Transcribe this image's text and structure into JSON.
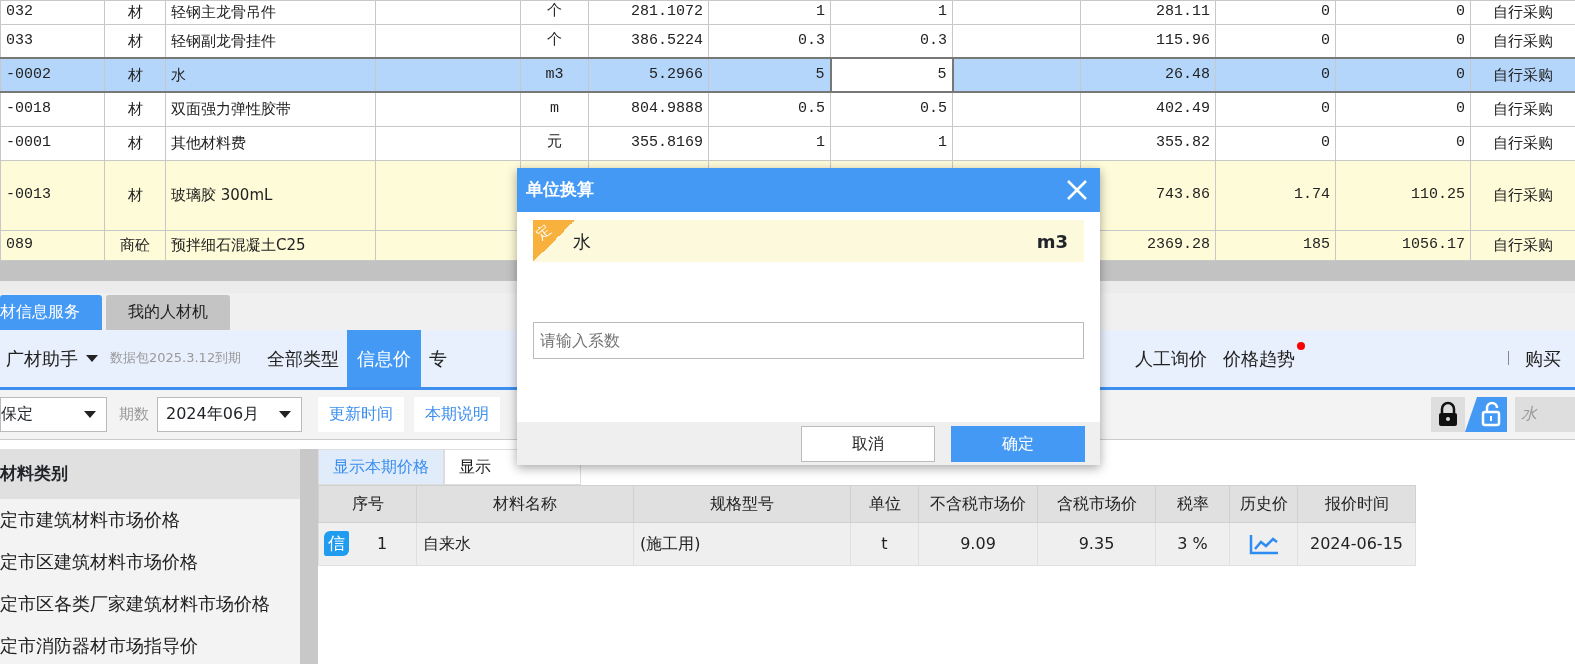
{
  "grid": {
    "rows": [
      {
        "selected": false,
        "highlight": false,
        "cells": {
          "column_1": "032",
          "column_2": "材",
          "column_3": "轻钢主龙骨吊件",
          "column_5": "个",
          "column_6": "281.1072",
          "column_7": "1",
          "column_8": "1",
          "column_10": "281.11",
          "column_11": "0",
          "column_12": "0",
          "column_13": "自行采购"
        }
      },
      {
        "selected": false,
        "highlight": false,
        "cells": {
          "column_1": "033",
          "column_2": "材",
          "column_3": "轻钢副龙骨挂件",
          "column_5": "个",
          "column_6": "386.5224",
          "column_7": "0.3",
          "column_8": "0.3",
          "column_10": "115.96",
          "column_11": "0",
          "column_12": "0",
          "column_13": "自行采购"
        }
      },
      {
        "selected": true,
        "highlight": false,
        "cells": {
          "column_1": "-0002",
          "column_2": "材",
          "column_3": "水",
          "column_5": "m3",
          "column_6": "5.2966",
          "column_7": "5",
          "column_8": {
            "text": "5",
            "focused": true
          },
          "column_10": "26.48",
          "column_11": "0",
          "column_12": "0",
          "column_13": "自行采购"
        }
      },
      {
        "selected": false,
        "highlight": false,
        "cells": {
          "column_1": "-0018",
          "column_2": "材",
          "column_3": "双面强力弹性胶带",
          "column_5": "m",
          "column_6": "804.9888",
          "column_7": "0.5",
          "column_8": "0.5",
          "column_10": "402.49",
          "column_11": "0",
          "column_12": "0",
          "column_13": "自行采购"
        }
      },
      {
        "selected": false,
        "highlight": false,
        "cells": {
          "column_1": "-0001",
          "column_2": "材",
          "column_3": "其他材料费",
          "column_5": "元",
          "column_6": "355.8169",
          "column_7": "1",
          "column_8": "1",
          "column_10": "355.82",
          "column_11": "0",
          "column_12": "0",
          "column_13": "自行采购"
        }
      },
      {
        "selected": false,
        "highlight": true,
        "cells": {
          "column_1": "-0013",
          "column_2": "材",
          "column_3": "玻璃胶 300mL",
          "column_10": "743.86",
          "column_11": "1.74",
          "column_12": "110.25",
          "column_13": "自行采购"
        }
      },
      {
        "selected": false,
        "highlight": true,
        "cells": {
          "column_1": "089",
          "column_2": "商砼",
          "column_3": "预拌细石混凝土C25",
          "column_10": "2369.28",
          "column_11": "185",
          "column_12": "1056.17",
          "column_13": "自行采购"
        }
      }
    ]
  },
  "pane_tabs": [
    {
      "label": "材信息服务",
      "selected": true
    },
    {
      "label": "我的人材机",
      "selected": false
    }
  ],
  "toolbar": {
    "brand": "广材助手",
    "notice": "数据包2025.3.12到期",
    "items": [
      {
        "label": "全部类型",
        "selected": false,
        "dot": false
      },
      {
        "label": "信息价",
        "selected": true,
        "dot": false
      },
      {
        "label": "专",
        "selected": false,
        "dot": false
      },
      {
        "label": "人工询价",
        "selected": false,
        "dot": false
      },
      {
        "label": "价格趋势",
        "selected": false,
        "dot": true
      }
    ],
    "buy": "购买"
  },
  "filters": {
    "region": "保定",
    "period_label": "期数",
    "period": "2024年06月",
    "buttons": [
      "更新时间",
      "本期说明"
    ],
    "locked": false,
    "search": {
      "value": "水"
    }
  },
  "categories": {
    "title": "材料类别",
    "items": [
      "定市建筑材料市场价格",
      "定市区建筑材料市场价格",
      "定市区各类厂家建筑材料市场价格",
      "定市消防器材市场指导价"
    ]
  },
  "price_tabs": [
    {
      "label": "显示本期价格",
      "selected": true
    },
    {
      "label": "显示",
      "selected": false
    }
  ],
  "price_table": {
    "columns": [
      "序号",
      "材料名称",
      "规格型号",
      "单位",
      "不含税市场价",
      "含税市场价",
      "税率",
      "历史价",
      "报价时间"
    ],
    "rows": [
      {
        "badge": "信",
        "index": "1",
        "name": "自来水",
        "spec": "(施工用)",
        "unit": "t",
        "price_ex_tax": "9.09",
        "price_inc_tax": "9.35",
        "tax_rate": "3 %",
        "date": "2024-06-15"
      }
    ]
  },
  "dialog": {
    "title": "单位换算",
    "corner_tag": "定",
    "item": "水",
    "unit": "m3",
    "input": {
      "placeholder": "请输入系数"
    },
    "buttons": [
      {
        "label": "取消",
        "primary": false
      },
      {
        "label": "确定",
        "primary": true
      }
    ]
  }
}
